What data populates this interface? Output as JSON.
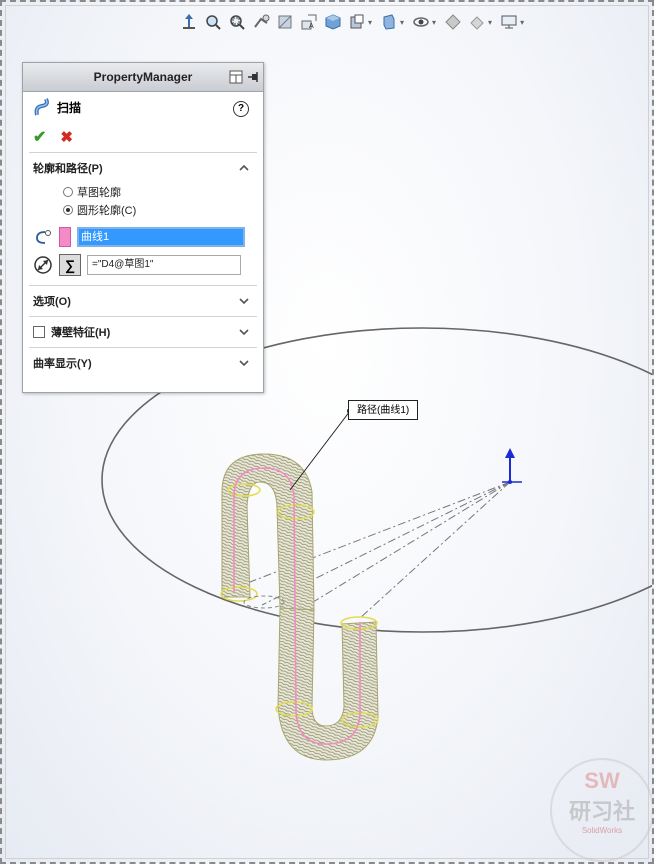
{
  "toolbar": {
    "icons": [
      "view-orientation-icon",
      "zoom-to-fit-icon",
      "zoom-to-area-icon",
      "previous-view-icon",
      "section-view-icon",
      "dynamic-annotation-icon",
      "view-cube-icon",
      "display-style-icon",
      "hide-show-icon",
      "edit-appearance-icon",
      "apply-scene-icon",
      "view-settings-icon"
    ]
  },
  "property_manager": {
    "title": "PropertyManager",
    "feature_name": "扫描",
    "help_label": "?",
    "ok_label": "✔",
    "cancel_label": "✖",
    "profile_path_section": {
      "title": "轮廓和路径(P)",
      "radio_sketch_profile": "草图轮廓",
      "radio_circular_profile": "圆形轮廓(C)",
      "selected_radio": "圆形轮廓(C)",
      "path_value": "曲线1",
      "diameter_value": "=\"D4@草图1\""
    },
    "options_section": {
      "title": "选项(O)"
    },
    "thin_feature_section": {
      "title": "薄壁特征(H)",
      "checked": false
    },
    "curvature_display_section": {
      "title": "曲率显示(Y)"
    }
  },
  "viewport": {
    "callout_label": "路径(曲线1)",
    "accent_color": "#e8352e",
    "path_color": "#f28bc6"
  },
  "watermark": {
    "brand": "SW",
    "name": "研习社",
    "sub": "SolidWorks"
  }
}
